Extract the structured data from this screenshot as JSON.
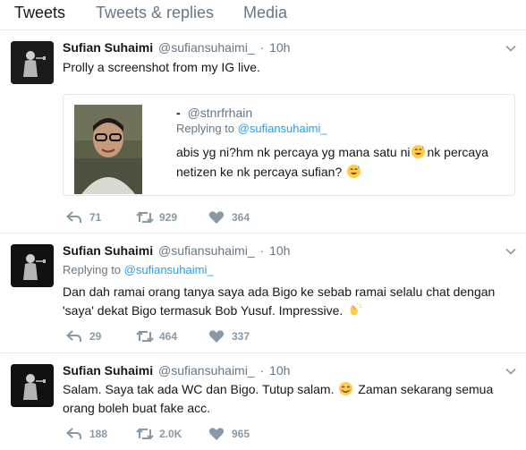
{
  "tabs": {
    "tweets": "Tweets",
    "replies": "Tweets & replies",
    "media": "Media"
  },
  "tweets": [
    {
      "name": "Sufian Suhaimi",
      "handle": "@sufiansuhaimi_",
      "dot": "·",
      "time": "10h",
      "text": "Prolly a screenshot from my IG live.",
      "quote": {
        "name": "-",
        "handle": "@stnrfrhain",
        "replying_prefix": "Replying to",
        "replying_handle": "@sufiansuhaimi_",
        "text_part1": "abis yg ni?hm nk percaya yg mana satu ni",
        "text_part2": "nk percaya netizen ke nk percaya sufian?",
        "emoji": "sweat-smile-emoji"
      },
      "replies": "71",
      "retweets": "929",
      "likes": "364"
    },
    {
      "name": "Sufian Suhaimi",
      "handle": "@sufiansuhaimi_",
      "dot": "·",
      "time": "10h",
      "replying_prefix": "Replying to",
      "replying_handle": "@sufiansuhaimi_",
      "text": "Dan dah ramai orang tanya saya ada Bigo ke sebab ramai selalu chat dengan 'saya' dekat Bigo termasuk Bob Yusuf. Impressive.",
      "emoji": "clapping-hands-emoji",
      "replies": "29",
      "retweets": "464",
      "likes": "337"
    },
    {
      "name": "Sufian Suhaimi",
      "handle": "@sufiansuhaimi_",
      "dot": "·",
      "time": "10h",
      "text_part1": "Salam. Saya tak ada WC dan Bigo. Tutup salam.",
      "text_part2": "Zaman sekarang semua orang boleh buat fake acc.",
      "emoji": "smiling-face-emoji",
      "replies": "188",
      "retweets": "2.0K",
      "likes": "965"
    }
  ],
  "colors": {
    "text": "#14171a",
    "secondary": "#657786",
    "link": "#1da1f2",
    "action": "#8899a6",
    "border": "#e6ecf0"
  },
  "icons": [
    "reply-icon",
    "retweet-icon",
    "like-icon",
    "caret-down-icon"
  ]
}
